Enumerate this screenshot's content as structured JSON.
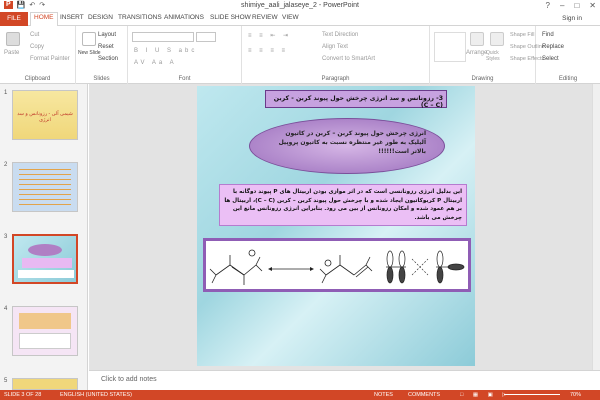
{
  "window": {
    "title": "shimiye_aali_jalaseye_2 - PowerPoint",
    "signin": "Sign in"
  },
  "tabs": [
    "FILE",
    "HOME",
    "INSERT",
    "DESIGN",
    "TRANSITIONS",
    "ANIMATIONS",
    "SLIDE SHOW",
    "REVIEW",
    "VIEW"
  ],
  "ribbon": {
    "clipboard": {
      "paste": "Paste",
      "cut": "Cut",
      "copy": "Copy",
      "format_painter": "Format Painter",
      "label": "Clipboard"
    },
    "slides": {
      "new_slide": "New Slide",
      "layout": "Layout",
      "reset": "Reset",
      "section": "Section",
      "label": "Slides"
    },
    "font": {
      "label": "Font"
    },
    "paragraph": {
      "text_direction": "Text Direction",
      "align_text": "Align Text",
      "smartart": "Convert to SmartArt",
      "label": "Paragraph"
    },
    "drawing": {
      "arrange": "Arrange",
      "quick_styles": "Quick Styles",
      "shape_fill": "Shape Fill",
      "shape_outline": "Shape Outline",
      "shape_effects": "Shape Effects",
      "label": "Drawing"
    },
    "editing": {
      "find": "Find",
      "replace": "Replace",
      "select": "Select",
      "label": "Editing"
    }
  },
  "thumbnails": [
    {
      "num": "1",
      "text": "شیمی آلی - رزونانس و سد انرژی"
    },
    {
      "num": "2",
      "text": ""
    },
    {
      "num": "3",
      "text": ""
    },
    {
      "num": "4",
      "text": ""
    },
    {
      "num": "5",
      "text": ""
    }
  ],
  "slide": {
    "title": "3- رزونانس و سد انرژی چرخش حول پیوند کربن - کربن (C – C)",
    "bubble": "انرژی چرخش حول پیوند کربن – کربن در کاتیون آلیلیک به طور غیر منتظره نسبت به کاتیون پروپیل بالاتر است!!!!!!",
    "body": "این بدلیل انرژی رزونانسی است که در اثر موازی بودن اربیتال های P پیوند دوگانه با اربیتال P کربوکاتیون ایجاد شده و با چرخش حول پیوند کربن – کربن (C – C)، اربیتال ها بر هم عمود شده و امکان رزونانس از بین می رود. بنابراین انرژی رزونانس مانع این چرخش می باشد."
  },
  "notes": "Click to add notes",
  "status": {
    "slide": "SLIDE 3 OF 28",
    "lang": "ENGLISH (UNITED STATES)",
    "notes": "NOTES",
    "comments": "COMMENTS",
    "zoom": "70%"
  },
  "colors": {
    "accent": "#d24726",
    "slide_bg": "#a9dde6",
    "bubble": "#b07fc4",
    "body_box": "#e8b9f2",
    "title_box": "#b98cd6"
  }
}
